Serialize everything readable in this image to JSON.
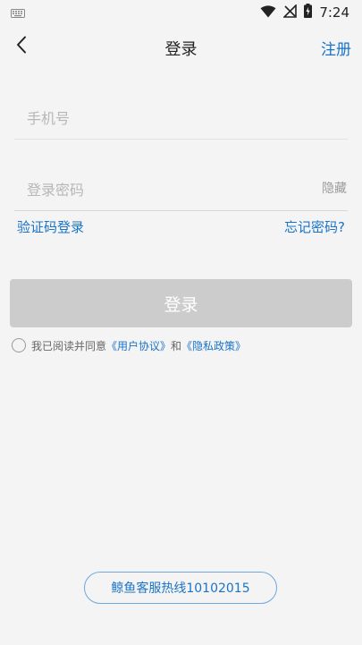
{
  "status_bar": {
    "time": "7:24",
    "icons": [
      "keyboard-icon",
      "wifi-icon",
      "no-signal-icon",
      "battery-charging-icon"
    ]
  },
  "nav": {
    "back_icon": "chevron-left-icon",
    "title": "登录",
    "right_action": "注册"
  },
  "form": {
    "phone_placeholder": "手机号",
    "phone_value": "",
    "password_placeholder": "登录密码",
    "password_value": "",
    "password_toggle": "隐藏"
  },
  "links": {
    "sms_login": "验证码登录",
    "forgot_password": "忘记密码?"
  },
  "login_button": "登录",
  "agreement": {
    "checked": false,
    "prefix": "我已阅读并同意",
    "user_agreement": "《用户协议》",
    "and": "和",
    "privacy_policy": "《隐私政策》"
  },
  "hotline": "鲸鱼客服热线10102015",
  "colors": {
    "background": "#f4f4f4",
    "accent": "#1a73c9",
    "button_disabled": "#cccccc",
    "placeholder": "#b7b7b7"
  }
}
